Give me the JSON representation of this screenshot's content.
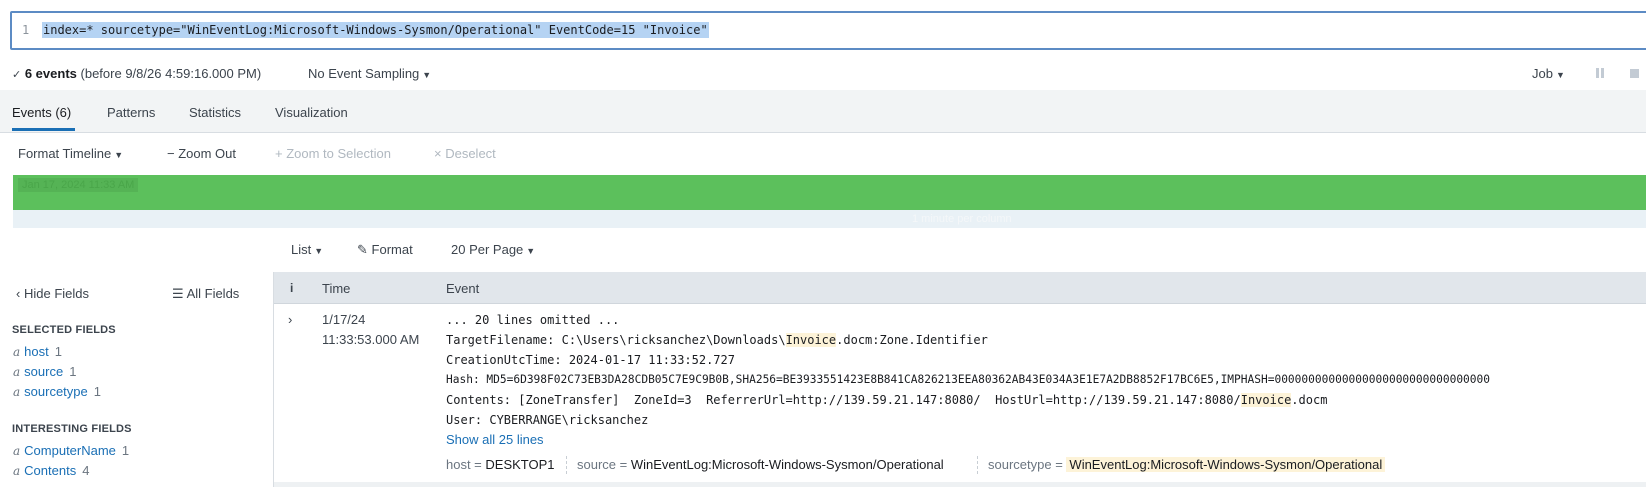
{
  "search": {
    "line_number": "1",
    "query": "index=* sourcetype=\"WinEventLog:Microsoft-Windows-Sysmon/Operational\" EventCode=15 \"Invoice\""
  },
  "status": {
    "events_count": "6 events",
    "before_text": "(before 9/8/26 4:59:16.000 PM)",
    "sampling": "No Event Sampling",
    "job": "Job"
  },
  "tabs": [
    {
      "label": "Events (6)",
      "active": true
    },
    {
      "label": "Patterns"
    },
    {
      "label": "Statistics"
    },
    {
      "label": "Visualization"
    }
  ],
  "timeline_toolbar": {
    "format": "Format Timeline",
    "zoom_out": "− Zoom Out",
    "zoom_selection": "+ Zoom to Selection",
    "deselect": "× Deselect"
  },
  "timeline": {
    "label": "Jan 17, 2024 11:33 AM",
    "scale": "1 minute per column",
    "bar_color": "#5cc05c"
  },
  "list_toolbar": {
    "list": "List",
    "format": "Format",
    "per_page": "20 Per Page"
  },
  "fields": {
    "hide": "Hide Fields",
    "all": "All Fields",
    "selected_title": "SELECTED FIELDS",
    "selected": [
      {
        "type": "a",
        "name": "host",
        "count": "1"
      },
      {
        "type": "a",
        "name": "source",
        "count": "1"
      },
      {
        "type": "a",
        "name": "sourcetype",
        "count": "1"
      }
    ],
    "interesting_title": "INTERESTING FIELDS",
    "interesting": [
      {
        "type": "a",
        "name": "ComputerName",
        "count": "1"
      },
      {
        "type": "a",
        "name": "Contents",
        "count": "4"
      }
    ]
  },
  "table": {
    "headers": {
      "info": "i",
      "time": "Time",
      "event": "Event"
    },
    "event": {
      "date": "1/17/24",
      "time": "11:33:53.000 AM",
      "lines": {
        "omitted": "... 20 lines omitted ...",
        "target_pre": "TargetFilename: C:\\Users\\ricksanchez\\Downloads\\",
        "target_hl": "Invoice",
        "target_post": ".docm:Zone.Identifier",
        "creation": "CreationUtcTime: 2024-01-17 11:33:52.727",
        "hash": "Hash: MD5=6D398F02C73EB3DA28CDB05C7E9C9B0B,SHA256=BE3933551423E8B841CA826213EEA80362AB43E034A3E1E7A2DB8852F17BC6E5,IMPHASH=00000000000000000000000000000000",
        "contents_pre": "Contents: [ZoneTransfer]  ZoneId=3  ReferrerUrl=http://139.59.21.147:8080/  HostUrl=http://139.59.21.147:8080/",
        "contents_hl": "Invoice",
        "contents_post": ".docm",
        "user": "User: CYBERRANGE\\ricksanchez"
      },
      "show_all": "Show all 25 lines",
      "kv": {
        "host_k": "host =",
        "host_v": "DESKTOP1",
        "source_k": "source =",
        "source_v": "WinEventLog:Microsoft-Windows-Sysmon/Operational",
        "sourcetype_k": "sourcetype =",
        "sourcetype_v": "WinEventLog:Microsoft-Windows-Sysmon/Operational"
      }
    }
  }
}
